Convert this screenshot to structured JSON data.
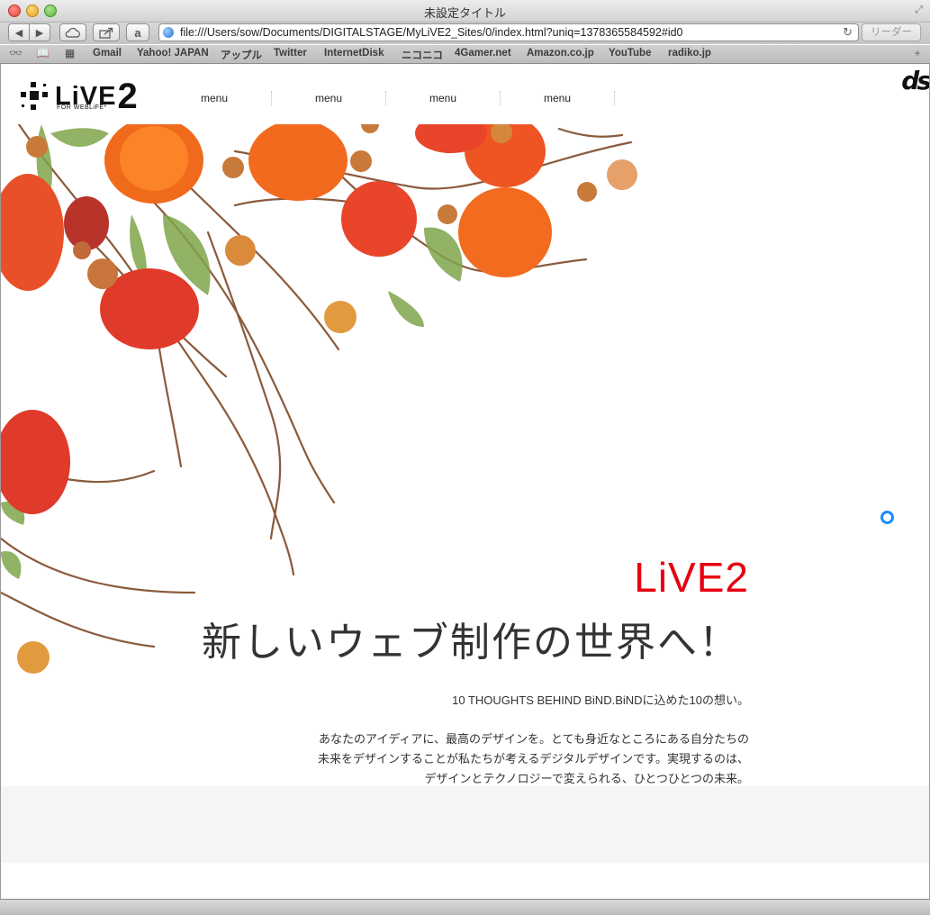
{
  "window": {
    "title": "未設定タイトル"
  },
  "toolbar": {
    "url": "file:///Users/sow/Documents/DIGITALSTAGE/MyLiVE2_Sites/0/index.html?uniq=1378365584592#id0",
    "reader_label": "リーダー",
    "amazon_label": "a"
  },
  "bookmarks": [
    "Gmail",
    "Yahoo! JAPAN",
    "アップル",
    "Twitter",
    "InternetDisk",
    "ニコニコ",
    "4Gamer.net",
    "Amazon.co.jp",
    "YouTube",
    "radiko.jp"
  ],
  "site": {
    "logo_text": "LiVE",
    "logo_number": "2",
    "logo_tagline": "FOR WEBLiFE*",
    "menu": [
      "menu",
      "menu",
      "menu",
      "menu"
    ],
    "corner_logo": "ds"
  },
  "hero": {
    "title": "LiVE2",
    "subtitle": "新しいウェブ制作の世界へ！",
    "caption": "10 THOUGHTS BEHIND BiND.BiNDに込めた10の想い。",
    "description": [
      "あなたのアイディアに、最高のデザインを。とても身近なところにある自分たちの",
      "未来をデザインすることが私たちが考えるデジタルデザインです。実現するのは、",
      "デザインとテクノロジーで変えられる、ひとつひとつの未来。"
    ]
  },
  "colors": {
    "accent": "#e60012",
    "text": "#333333",
    "footer_band": "#f5f5f5",
    "cursor": "#1a8cff"
  }
}
